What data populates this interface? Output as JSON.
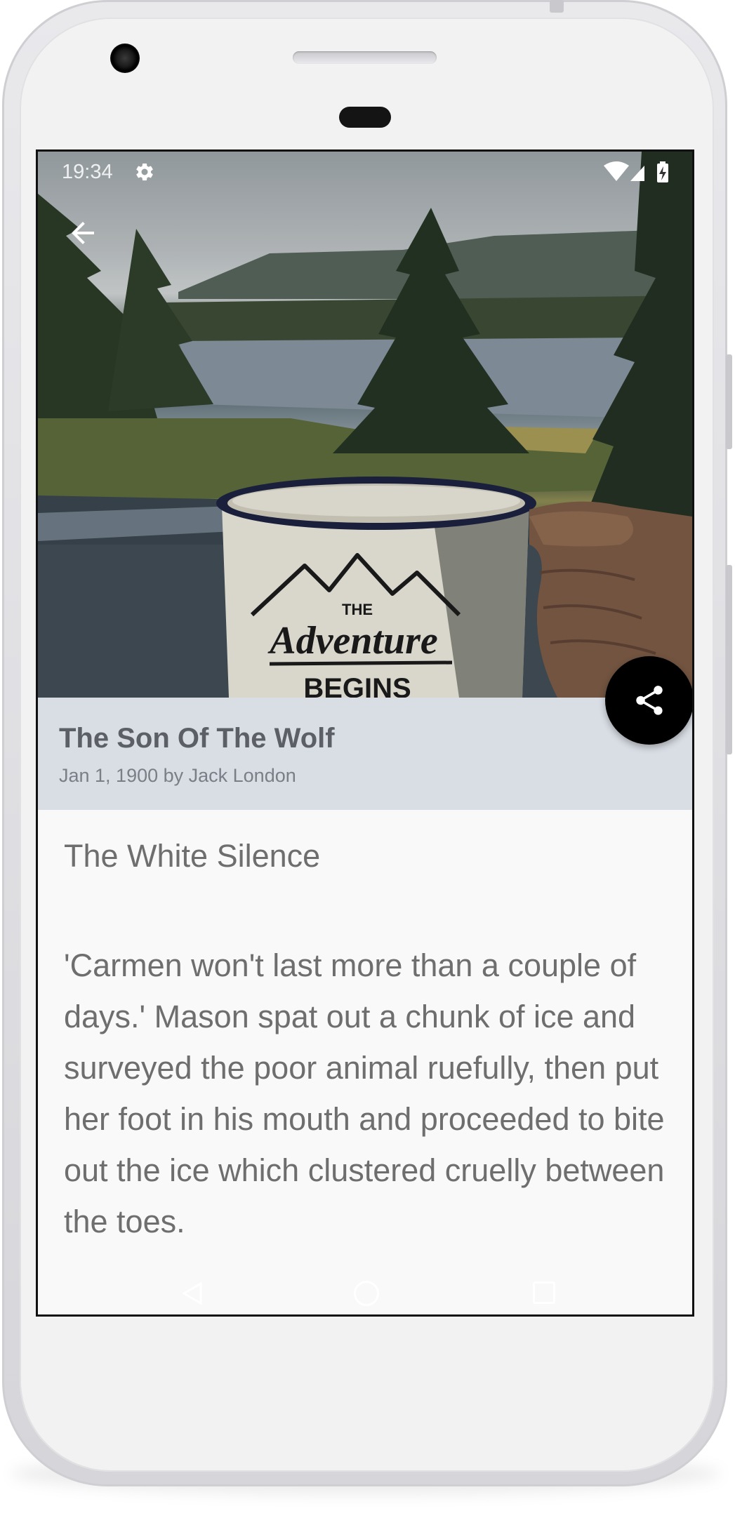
{
  "status_bar": {
    "time": "19:34",
    "icons": [
      "gear-icon",
      "wifi-icon",
      "signal-icon",
      "battery-charging-icon"
    ]
  },
  "book": {
    "title": "The Son Of The Wolf",
    "meta": "Jan 1, 1900 by Jack London"
  },
  "chapter": {
    "title": "The White Silence",
    "body": "'Carmen won't last more than a couple of days.' Mason spat out a chunk of ice and surveyed the poor animal ruefully, then put her foot in his mouth and proceeded to bite out the ice which clustered cruelly between the toes."
  },
  "actions": {
    "back_icon": "arrow-back-icon",
    "share_icon": "share-icon"
  },
  "nav_bar": {
    "buttons": [
      "nav-back-icon",
      "nav-home-icon",
      "nav-recent-icon"
    ]
  },
  "colors": {
    "title_bar": "#d9dee5",
    "content_bg": "#f9f9f9",
    "text": "#6e6e6e",
    "fab": "#000000"
  }
}
